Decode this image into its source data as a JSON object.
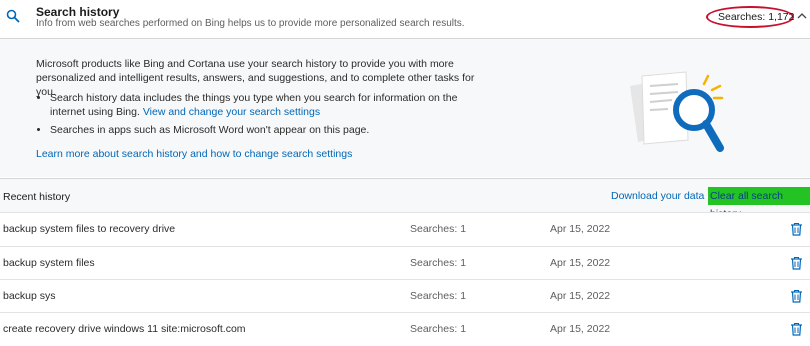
{
  "header": {
    "title": "Search history",
    "subtitle": "Info from web searches performed on Bing helps us to provide more personalized search results.",
    "count": "Searches: 1,172"
  },
  "info": {
    "paragraph": "Microsoft products like Bing and Cortana use your search history to provide you with more personalized and intelligent results, answers, and suggestions, and to complete other tasks for you.",
    "bullet1_text": "Search history data includes the things you type when you search for information on the internet using Bing.",
    "bullet1_link": "View and change your search settings",
    "bullet2_text": "Searches in apps such as Microsoft Word won't appear on this page.",
    "learn_more": "Learn more about search history and how to change search settings"
  },
  "recent": {
    "label": "Recent history",
    "download": "Download your data",
    "clear_all": "Clear all search history"
  },
  "rows": [
    {
      "query": "backup system files to recovery drive",
      "searches": "Searches: 1",
      "date": "Apr 15, 2022"
    },
    {
      "query": "backup system files",
      "searches": "Searches: 1",
      "date": "Apr 15, 2022"
    },
    {
      "query": "backup sys",
      "searches": "Searches: 1",
      "date": "Apr 15, 2022"
    },
    {
      "query": "create recovery drive windows 11 site:microsoft.com",
      "searches": "Searches: 1",
      "date": "Apr 15, 2022"
    }
  ],
  "icons": {
    "header": "search-icon",
    "illustration": "document-magnifier-illustration",
    "toggle": "chevron-up-icon",
    "row_action": "trash-icon"
  },
  "colors": {
    "link": "#0067b8",
    "annotation_circle": "#c8102e",
    "highlight": "#22c322",
    "illustration_blue": "#0f6cbd",
    "illustration_yellow": "#f5b400"
  }
}
